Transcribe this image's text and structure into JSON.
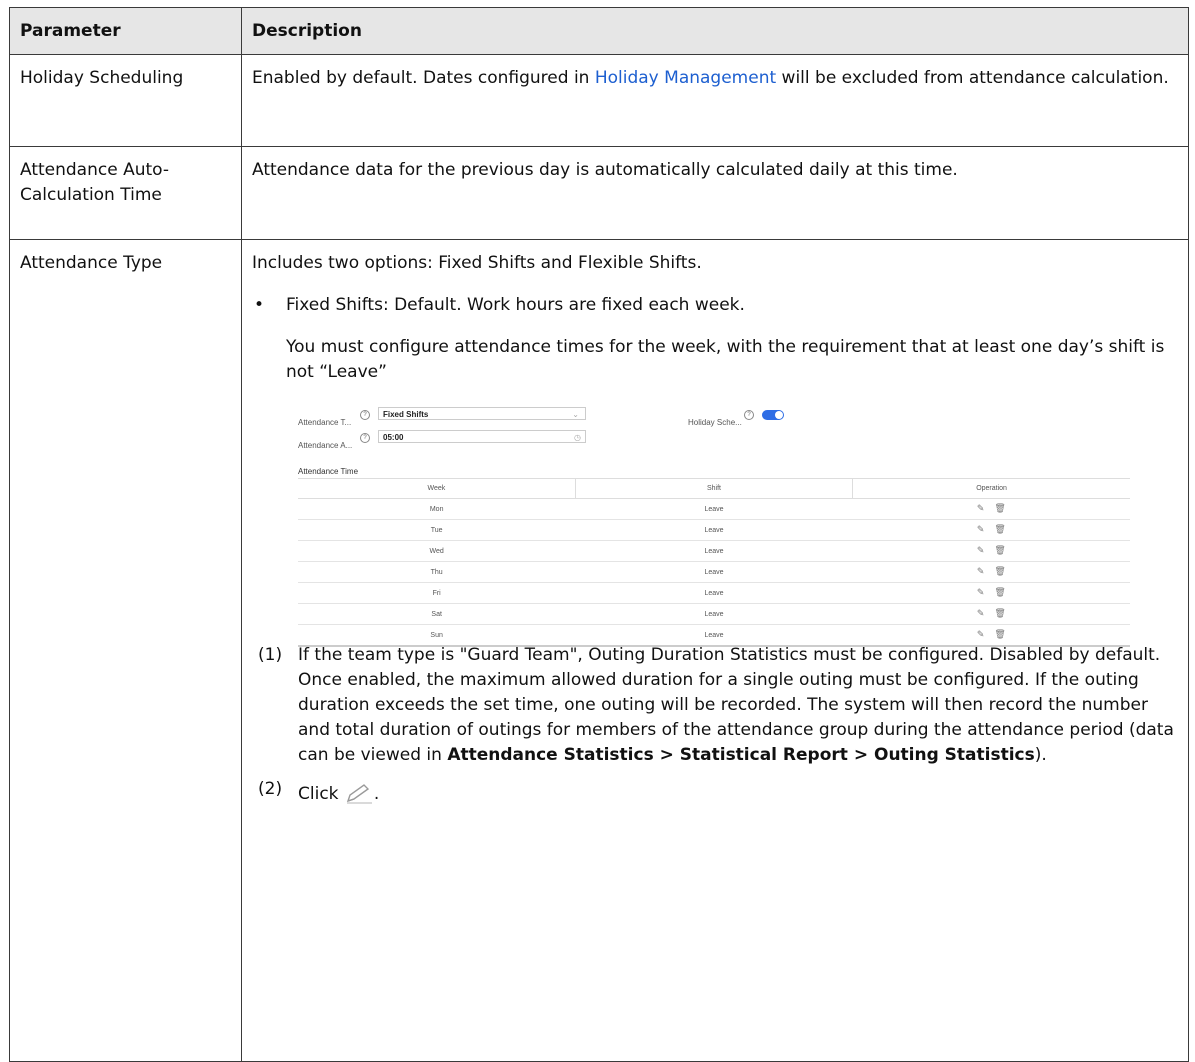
{
  "table": {
    "header": {
      "param": "Parameter",
      "desc": "Description"
    },
    "rows": [
      {
        "param": "Holiday Scheduling",
        "desc_before": "Enabled by default. Dates configured in ",
        "desc_link": "Holiday Management",
        "desc_after": " will be excluded from attendance calculation."
      },
      {
        "param": "Attendance Auto-Calculation Time",
        "desc": "Attendance data for the previous day is automatically calculated daily at this time."
      },
      {
        "param": "Attendance Type",
        "intro": "Includes two options: Fixed Shifts and Flexible Shifts.",
        "bullet": "Fixed Shifts: Default. Work hours are fixed each week.",
        "bullet_para": "You must configure attendance times for the week, with the requirement that at least one day’s shift is not “Leave”",
        "step1_num": "(1)",
        "step1_text": "If the team type is \"Guard Team\", Outing Duration Statistics must be configured. Disabled by default. Once enabled, the maximum allowed duration for a single outing must be configured. If the outing duration exceeds the set time, one outing will be recorded. The system will then record the number and total duration of outings for members of the attendance group during the attendance period (data can be viewed in ",
        "step1_bold": "Attendance Statistics > Statistical Report > Outing Statistics",
        "step1_end": ").",
        "step2_num": "(2)",
        "step2_text": "Click ",
        "step2_end": "."
      }
    ]
  },
  "screenshot": {
    "type_label": "Attendance T...",
    "type_value": "Fixed Shifts",
    "holiday_label": "Holiday Sche...",
    "auto_label": "Attendance A...",
    "auto_value": "05:00",
    "section_title": "Attendance Time",
    "columns": [
      "Week",
      "Shift",
      "Operation"
    ],
    "rows": [
      {
        "week": "Mon",
        "shift": "Leave"
      },
      {
        "week": "Tue",
        "shift": "Leave"
      },
      {
        "week": "Wed",
        "shift": "Leave"
      },
      {
        "week": "Thu",
        "shift": "Leave"
      },
      {
        "week": "Fri",
        "shift": "Leave"
      },
      {
        "week": "Sat",
        "shift": "Leave"
      },
      {
        "week": "Sun",
        "shift": "Leave"
      }
    ],
    "toggle_on": true,
    "accent": "#2e6de5",
    "link_color": "#1d5fd0"
  }
}
